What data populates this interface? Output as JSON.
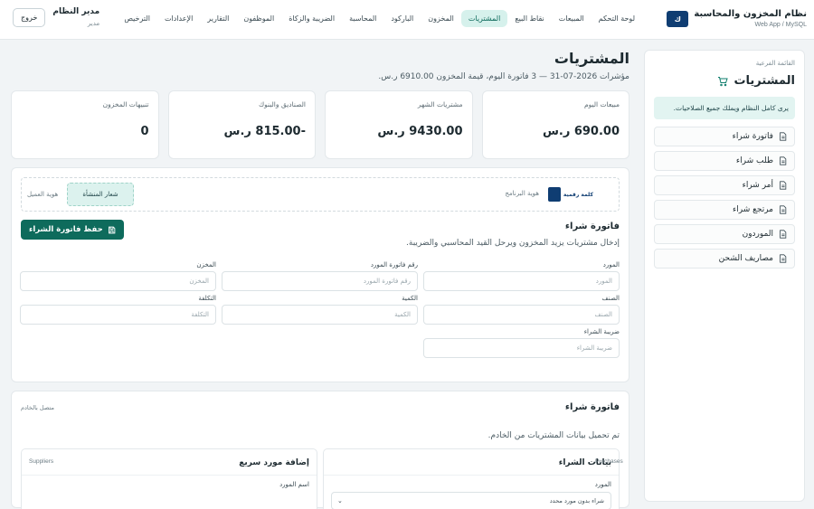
{
  "app": {
    "title": "نظام المخزون والمحاسبة",
    "subtitle": "Web App / MySQL",
    "logo_text": "كلمة رقمية"
  },
  "nav": [
    {
      "label": "لوحة التحكم"
    },
    {
      "label": "المبيعات"
    },
    {
      "label": "نقاط البيع"
    },
    {
      "label": "المشتريات",
      "active": true
    },
    {
      "label": "المخزون"
    },
    {
      "label": "الباركود"
    },
    {
      "label": "المحاسبة"
    },
    {
      "label": "الضريبة والزكاة"
    },
    {
      "label": "الموظفون"
    },
    {
      "label": "التقارير"
    },
    {
      "label": "الإعدادات"
    },
    {
      "label": "الترخيص"
    }
  ],
  "user": {
    "name": "مدير النظام",
    "role": "مدير",
    "logout_label": "خروج"
  },
  "sidebar": {
    "caption": "القائمة الفرعية",
    "title": "المشتريات",
    "note": "يرى كامل النظام ويملك جميع الصلاحيات.",
    "items": [
      {
        "label": "فاتورة شراء"
      },
      {
        "label": "طلب شراء"
      },
      {
        "label": "أمر شراء"
      },
      {
        "label": "مرتجع شراء"
      },
      {
        "label": "الموردون"
      },
      {
        "label": "مصاريف الشحن"
      }
    ]
  },
  "page": {
    "title": "المشتريات",
    "meta": "مؤشرات 2026-07-31 — 3 فاتورة اليوم، قيمة المخزون 6910.00 ر.س."
  },
  "stats": [
    {
      "label": "مبيعات اليوم",
      "value": "690.00 ر.س"
    },
    {
      "label": "مشتريات الشهر",
      "value": "9430.00 ر.س"
    },
    {
      "label": "الصناديق والبنوك",
      "value": "-815.00 ر.س"
    },
    {
      "label": "تنبيهات المخزون",
      "value": "0"
    }
  ],
  "identity": {
    "program_label": "هوية البرنامج",
    "client_label": "هوية العميل",
    "slogan": "شعار المنشأة"
  },
  "invoice": {
    "title": "فاتورة شراء",
    "description": "إدخال مشتريات يزيد المخزون ويرحل القيد المحاسبي والضريبة.",
    "save_label": "حفظ فاتورة الشراء",
    "fields": [
      {
        "label": "المورد",
        "placeholder": "المورد"
      },
      {
        "label": "رقم فاتورة المورد",
        "placeholder": "رقم فاتورة المورد"
      },
      {
        "label": "المخزن",
        "placeholder": "المخزن"
      },
      {
        "label": "الصنف",
        "placeholder": "الصنف"
      },
      {
        "label": "الكمية",
        "placeholder": "الكمية"
      },
      {
        "label": "التكلفة",
        "placeholder": "التكلفة"
      },
      {
        "label": "ضريبة الشراء",
        "placeholder": "ضريبة الشراء"
      }
    ]
  },
  "data_panel": {
    "title": "فاتورة شراء",
    "connection": "متصل بالخادم",
    "description": "تم تحميل بيانات المشتريات من الخادم.",
    "purchases": {
      "title": "بيانات الشراء",
      "tag": "Purchases",
      "field_label": "المورد",
      "selected": "شراء بدون مورد محدد"
    },
    "suppliers": {
      "title": "إضافة مورد سريع",
      "tag": "Suppliers",
      "field_label": "اسم المورد"
    }
  }
}
